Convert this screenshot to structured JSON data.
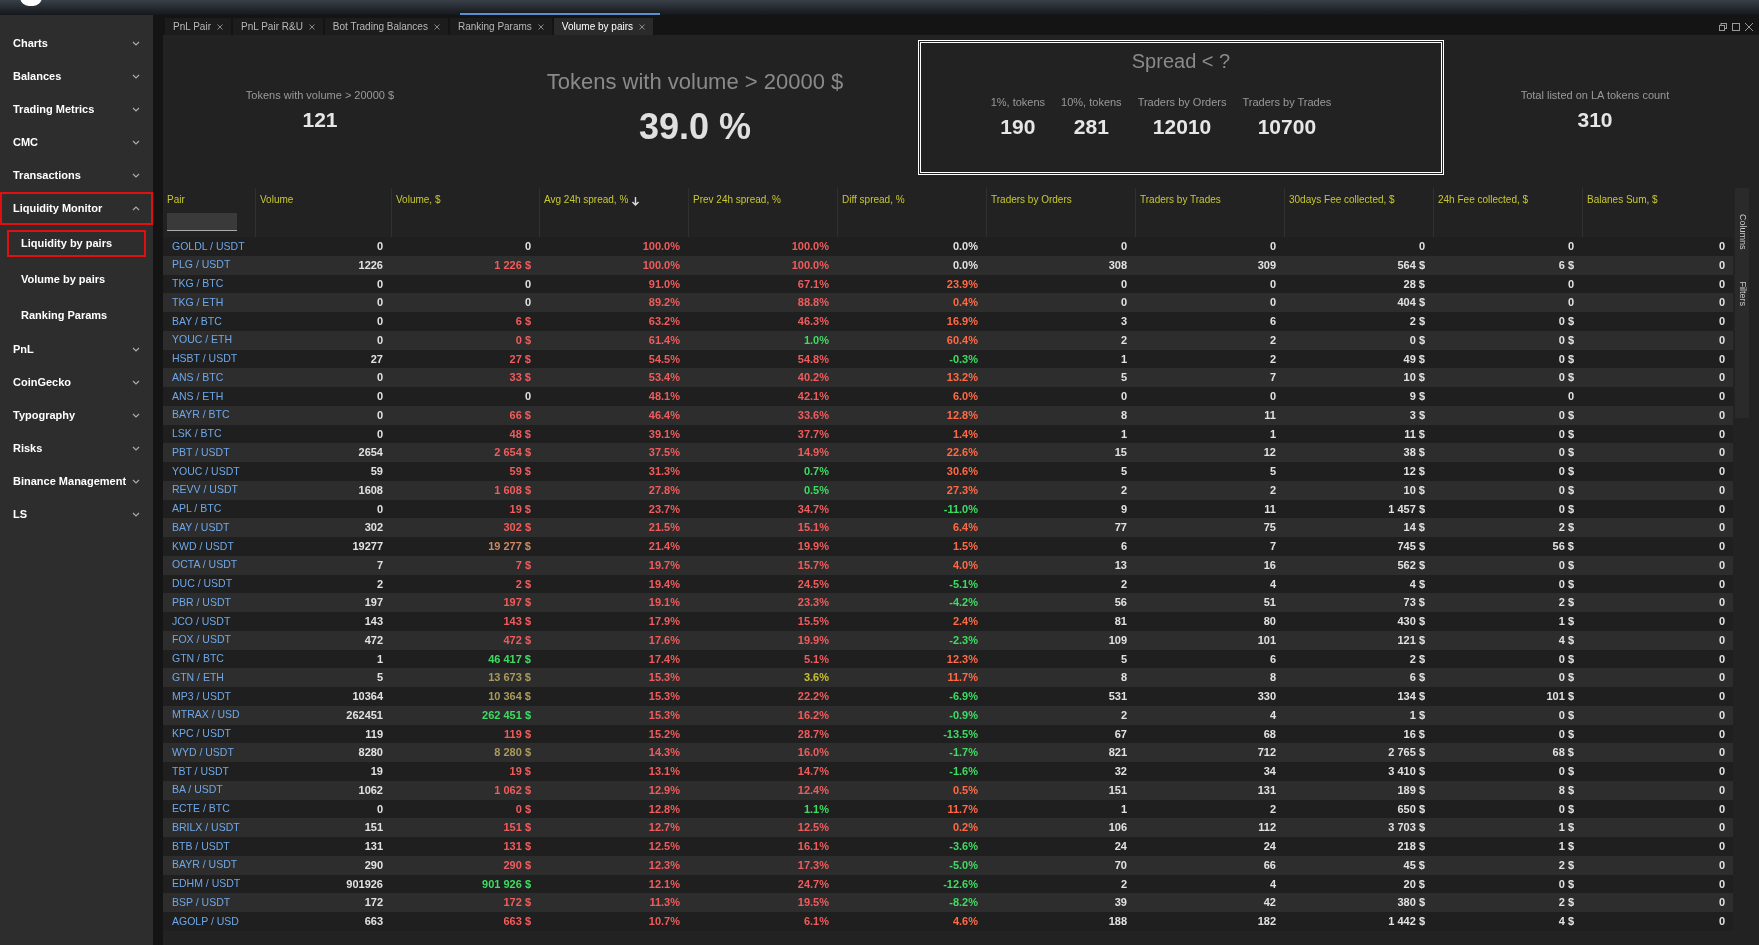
{
  "sidebar": {
    "items": [
      {
        "label": "Charts",
        "expanded": false
      },
      {
        "label": "Balances",
        "expanded": false
      },
      {
        "label": "Trading Metrics",
        "expanded": false
      },
      {
        "label": "CMC",
        "expanded": false
      },
      {
        "label": "Transactions",
        "expanded": false
      },
      {
        "label": "Liquidity Monitor",
        "expanded": true,
        "children": [
          {
            "label": "Liquidity by pairs",
            "selected": true
          },
          {
            "label": "Volume by pairs",
            "selected": false
          },
          {
            "label": "Ranking Params",
            "selected": false
          }
        ]
      },
      {
        "label": "PnL",
        "expanded": false
      },
      {
        "label": "CoinGecko",
        "expanded": false
      },
      {
        "label": "Typography",
        "expanded": false
      },
      {
        "label": "Risks",
        "expanded": false
      },
      {
        "label": "Binance Management",
        "expanded": false
      },
      {
        "label": "LS",
        "expanded": false
      }
    ]
  },
  "tabs": [
    {
      "label": "PnL Pair",
      "selected": false
    },
    {
      "label": "PnL Pair R&U",
      "selected": false
    },
    {
      "label": "Bot Trading Balances",
      "selected": false
    },
    {
      "label": "Ranking Params",
      "selected": false
    },
    {
      "label": "Volume by pairs",
      "selected": true
    }
  ],
  "stats": {
    "small": {
      "label": "Tokens with volume > 20000 $",
      "value": "121"
    },
    "big": {
      "label": "Tokens with volume > 20000 $",
      "value": "39.0 %"
    },
    "spread": {
      "title": "Spread < ?",
      "items": [
        {
          "label": "1%, tokens",
          "value": "190"
        },
        {
          "label": "10%, tokens",
          "value": "281"
        },
        {
          "label": "Traders by Orders",
          "value": "12010"
        },
        {
          "label": "Traders by Trades",
          "value": "10700"
        }
      ]
    },
    "total": {
      "label": "Total listed on LA tokens count",
      "value": "310"
    }
  },
  "table": {
    "columns": [
      {
        "label": "Pair",
        "sorted": false
      },
      {
        "label": "Volume",
        "sorted": false
      },
      {
        "label": "Volume, $",
        "sorted": false
      },
      {
        "label": "Avg 24h spread, %",
        "sorted": true
      },
      {
        "label": "Prev 24h spread, %",
        "sorted": false
      },
      {
        "label": "Diff spread, %",
        "sorted": false
      },
      {
        "label": "Traders by Orders",
        "sorted": false
      },
      {
        "label": "Traders by Trades",
        "sorted": false
      },
      {
        "label": "30days Fee collected, $",
        "sorted": false
      },
      {
        "label": "24h Fee collected, $",
        "sorted": false
      },
      {
        "label": "Balanes Sum, $",
        "sorted": false
      }
    ],
    "rows": [
      {
        "pair": "GOLDL / USDT",
        "cells": [
          {
            "text": "0"
          },
          {
            "text": "0"
          },
          {
            "text": "100.0%",
            "color": "#f05c5c"
          },
          {
            "text": "100.0%",
            "color": "#f05c5c"
          },
          {
            "text": "0.0%"
          },
          {
            "text": "0"
          },
          {
            "text": "0"
          },
          {
            "text": "0"
          },
          {
            "text": "0"
          },
          {
            "text": "0"
          }
        ]
      },
      {
        "pair": "PLG / USDT",
        "cells": [
          {
            "text": "1226"
          },
          {
            "text": "1 226 $",
            "color": "#f05c5c"
          },
          {
            "text": "100.0%",
            "color": "#f05c5c"
          },
          {
            "text": "100.0%",
            "color": "#f05c5c"
          },
          {
            "text": "0.0%"
          },
          {
            "text": "308"
          },
          {
            "text": "309"
          },
          {
            "text": "564 $"
          },
          {
            "text": "6 $"
          },
          {
            "text": "0"
          }
        ]
      },
      {
        "pair": "TKG / BTC",
        "cells": [
          {
            "text": "0"
          },
          {
            "text": "0"
          },
          {
            "text": "91.0%",
            "color": "#f05c5c"
          },
          {
            "text": "67.1%",
            "color": "#f05c5c"
          },
          {
            "text": "23.9%",
            "color": "#ff6a45"
          },
          {
            "text": "0"
          },
          {
            "text": "0"
          },
          {
            "text": "28 $"
          },
          {
            "text": "0"
          },
          {
            "text": "0"
          }
        ]
      },
      {
        "pair": "TKG / ETH",
        "cells": [
          {
            "text": "0"
          },
          {
            "text": "0"
          },
          {
            "text": "89.2%",
            "color": "#f05c5c"
          },
          {
            "text": "88.8%",
            "color": "#f05c5c"
          },
          {
            "text": "0.4%",
            "color": "#ff6a45"
          },
          {
            "text": "0"
          },
          {
            "text": "0"
          },
          {
            "text": "404 $"
          },
          {
            "text": "0"
          },
          {
            "text": "0"
          }
        ]
      },
      {
        "pair": "BAY / BTC",
        "cells": [
          {
            "text": "0"
          },
          {
            "text": "6 $",
            "color": "#f05c5c"
          },
          {
            "text": "63.2%",
            "color": "#f05c5c"
          },
          {
            "text": "46.3%",
            "color": "#f05c5c"
          },
          {
            "text": "16.9%",
            "color": "#ff6a45"
          },
          {
            "text": "3"
          },
          {
            "text": "6"
          },
          {
            "text": "2 $"
          },
          {
            "text": "0 $"
          },
          {
            "text": "0"
          }
        ]
      },
      {
        "pair": "YOUC / ETH",
        "cells": [
          {
            "text": "0"
          },
          {
            "text": "0 $",
            "color": "#f05c5c"
          },
          {
            "text": "61.4%",
            "color": "#f05c5c"
          },
          {
            "text": "1.0%",
            "color": "#3ddc62"
          },
          {
            "text": "60.4%",
            "color": "#ff6a45"
          },
          {
            "text": "2"
          },
          {
            "text": "2"
          },
          {
            "text": "0 $"
          },
          {
            "text": "0 $"
          },
          {
            "text": "0"
          }
        ]
      },
      {
        "pair": "HSBT / USDT",
        "cells": [
          {
            "text": "27"
          },
          {
            "text": "27 $",
            "color": "#f05c5c"
          },
          {
            "text": "54.5%",
            "color": "#f05c5c"
          },
          {
            "text": "54.8%",
            "color": "#f05c5c"
          },
          {
            "text": "-0.3%",
            "color": "#3ddc62"
          },
          {
            "text": "1"
          },
          {
            "text": "2"
          },
          {
            "text": "49 $"
          },
          {
            "text": "0 $"
          },
          {
            "text": "0"
          }
        ]
      },
      {
        "pair": "ANS / BTC",
        "cells": [
          {
            "text": "0"
          },
          {
            "text": "33 $",
            "color": "#f05c5c"
          },
          {
            "text": "53.4%",
            "color": "#f05c5c"
          },
          {
            "text": "40.2%",
            "color": "#f05c5c"
          },
          {
            "text": "13.2%",
            "color": "#ff6a45"
          },
          {
            "text": "5"
          },
          {
            "text": "7"
          },
          {
            "text": "10 $"
          },
          {
            "text": "0 $"
          },
          {
            "text": "0"
          }
        ]
      },
      {
        "pair": "ANS / ETH",
        "cells": [
          {
            "text": "0"
          },
          {
            "text": "0"
          },
          {
            "text": "48.1%",
            "color": "#f05c5c"
          },
          {
            "text": "42.1%",
            "color": "#f05c5c"
          },
          {
            "text": "6.0%",
            "color": "#ff6a45"
          },
          {
            "text": "0"
          },
          {
            "text": "0"
          },
          {
            "text": "9 $"
          },
          {
            "text": "0"
          },
          {
            "text": "0"
          }
        ]
      },
      {
        "pair": "BAYR / BTC",
        "cells": [
          {
            "text": "0"
          },
          {
            "text": "66 $",
            "color": "#f05c5c"
          },
          {
            "text": "46.4%",
            "color": "#f05c5c"
          },
          {
            "text": "33.6%",
            "color": "#f05c5c"
          },
          {
            "text": "12.8%",
            "color": "#ff6a45"
          },
          {
            "text": "8"
          },
          {
            "text": "11"
          },
          {
            "text": "3 $"
          },
          {
            "text": "0 $"
          },
          {
            "text": "0"
          }
        ]
      },
      {
        "pair": "LSK / BTC",
        "cells": [
          {
            "text": "0"
          },
          {
            "text": "48 $",
            "color": "#f05c5c"
          },
          {
            "text": "39.1%",
            "color": "#f05c5c"
          },
          {
            "text": "37.7%",
            "color": "#f05c5c"
          },
          {
            "text": "1.4%",
            "color": "#ff6a45"
          },
          {
            "text": "1"
          },
          {
            "text": "1"
          },
          {
            "text": "11 $"
          },
          {
            "text": "0 $"
          },
          {
            "text": "0"
          }
        ]
      },
      {
        "pair": "PBT / USDT",
        "cells": [
          {
            "text": "2654"
          },
          {
            "text": "2 654 $",
            "color": "#f05c5c"
          },
          {
            "text": "37.5%",
            "color": "#f05c5c"
          },
          {
            "text": "14.9%",
            "color": "#f05c5c"
          },
          {
            "text": "22.6%",
            "color": "#ff6a45"
          },
          {
            "text": "15"
          },
          {
            "text": "12"
          },
          {
            "text": "38 $"
          },
          {
            "text": "0 $"
          },
          {
            "text": "0"
          }
        ]
      },
      {
        "pair": "YOUC / USDT",
        "cells": [
          {
            "text": "59"
          },
          {
            "text": "59 $",
            "color": "#f05c5c"
          },
          {
            "text": "31.3%",
            "color": "#f05c5c"
          },
          {
            "text": "0.7%",
            "color": "#3ddc62"
          },
          {
            "text": "30.6%",
            "color": "#ff6a45"
          },
          {
            "text": "5"
          },
          {
            "text": "5"
          },
          {
            "text": "12 $"
          },
          {
            "text": "0 $"
          },
          {
            "text": "0"
          }
        ]
      },
      {
        "pair": "REVV / USDT",
        "cells": [
          {
            "text": "1608"
          },
          {
            "text": "1 608 $",
            "color": "#f05c5c"
          },
          {
            "text": "27.8%",
            "color": "#f05c5c"
          },
          {
            "text": "0.5%",
            "color": "#3ddc62"
          },
          {
            "text": "27.3%",
            "color": "#ff6a45"
          },
          {
            "text": "2"
          },
          {
            "text": "2"
          },
          {
            "text": "10 $"
          },
          {
            "text": "0 $"
          },
          {
            "text": "0"
          }
        ]
      },
      {
        "pair": "APL / BTC",
        "cells": [
          {
            "text": "0"
          },
          {
            "text": "19 $",
            "color": "#f05c5c"
          },
          {
            "text": "23.7%",
            "color": "#f05c5c"
          },
          {
            "text": "34.7%",
            "color": "#f05c5c"
          },
          {
            "text": "-11.0%",
            "color": "#3ddc62"
          },
          {
            "text": "9"
          },
          {
            "text": "11"
          },
          {
            "text": "1 457 $"
          },
          {
            "text": "0 $"
          },
          {
            "text": "0"
          }
        ]
      },
      {
        "pair": "BAY / USDT",
        "cells": [
          {
            "text": "302"
          },
          {
            "text": "302 $",
            "color": "#f05c5c"
          },
          {
            "text": "21.5%",
            "color": "#f05c5c"
          },
          {
            "text": "15.1%",
            "color": "#f05c5c"
          },
          {
            "text": "6.4%",
            "color": "#ff6a45"
          },
          {
            "text": "77"
          },
          {
            "text": "75"
          },
          {
            "text": "14 $"
          },
          {
            "text": "2 $"
          },
          {
            "text": "0"
          }
        ]
      },
      {
        "pair": "KWD / USDT",
        "cells": [
          {
            "text": "19277"
          },
          {
            "text": "19 277 $",
            "color": "#c98a66"
          },
          {
            "text": "21.4%",
            "color": "#f05c5c"
          },
          {
            "text": "19.9%",
            "color": "#f05c5c"
          },
          {
            "text": "1.5%",
            "color": "#ff6a45"
          },
          {
            "text": "6"
          },
          {
            "text": "7"
          },
          {
            "text": "745 $"
          },
          {
            "text": "56 $"
          },
          {
            "text": "0"
          }
        ]
      },
      {
        "pair": "OCTA / USDT",
        "cells": [
          {
            "text": "7"
          },
          {
            "text": "7 $",
            "color": "#f05c5c"
          },
          {
            "text": "19.7%",
            "color": "#f05c5c"
          },
          {
            "text": "15.7%",
            "color": "#f05c5c"
          },
          {
            "text": "4.0%",
            "color": "#ff6a45"
          },
          {
            "text": "13"
          },
          {
            "text": "16"
          },
          {
            "text": "562 $"
          },
          {
            "text": "0 $"
          },
          {
            "text": "0"
          }
        ]
      },
      {
        "pair": "DUC / USDT",
        "cells": [
          {
            "text": "2"
          },
          {
            "text": "2 $",
            "color": "#f05c5c"
          },
          {
            "text": "19.4%",
            "color": "#f05c5c"
          },
          {
            "text": "24.5%",
            "color": "#f05c5c"
          },
          {
            "text": "-5.1%",
            "color": "#3ddc62"
          },
          {
            "text": "2"
          },
          {
            "text": "4"
          },
          {
            "text": "4 $"
          },
          {
            "text": "0 $"
          },
          {
            "text": "0"
          }
        ]
      },
      {
        "pair": "PBR / USDT",
        "cells": [
          {
            "text": "197"
          },
          {
            "text": "197 $",
            "color": "#f05c5c"
          },
          {
            "text": "19.1%",
            "color": "#f05c5c"
          },
          {
            "text": "23.3%",
            "color": "#f05c5c"
          },
          {
            "text": "-4.2%",
            "color": "#3ddc62"
          },
          {
            "text": "56"
          },
          {
            "text": "51"
          },
          {
            "text": "73 $"
          },
          {
            "text": "2 $"
          },
          {
            "text": "0"
          }
        ]
      },
      {
        "pair": "JCO / USDT",
        "cells": [
          {
            "text": "143"
          },
          {
            "text": "143 $",
            "color": "#f05c5c"
          },
          {
            "text": "17.9%",
            "color": "#f05c5c"
          },
          {
            "text": "15.5%",
            "color": "#f05c5c"
          },
          {
            "text": "2.4%",
            "color": "#ff6a45"
          },
          {
            "text": "81"
          },
          {
            "text": "80"
          },
          {
            "text": "430 $"
          },
          {
            "text": "1 $"
          },
          {
            "text": "0"
          }
        ]
      },
      {
        "pair": "FOX / USDT",
        "cells": [
          {
            "text": "472"
          },
          {
            "text": "472 $",
            "color": "#f05c5c"
          },
          {
            "text": "17.6%",
            "color": "#f05c5c"
          },
          {
            "text": "19.9%",
            "color": "#f05c5c"
          },
          {
            "text": "-2.3%",
            "color": "#3ddc62"
          },
          {
            "text": "109"
          },
          {
            "text": "101"
          },
          {
            "text": "121 $"
          },
          {
            "text": "4 $"
          },
          {
            "text": "0"
          }
        ]
      },
      {
        "pair": "GTN / BTC",
        "cells": [
          {
            "text": "1"
          },
          {
            "text": "46 417 $",
            "color": "#3ddc62"
          },
          {
            "text": "17.4%",
            "color": "#f05c5c"
          },
          {
            "text": "5.1%",
            "color": "#f05c5c"
          },
          {
            "text": "12.3%",
            "color": "#ff6a45"
          },
          {
            "text": "5"
          },
          {
            "text": "6"
          },
          {
            "text": "2 $"
          },
          {
            "text": "0 $"
          },
          {
            "text": "0"
          }
        ]
      },
      {
        "pair": "GTN / ETH",
        "cells": [
          {
            "text": "5"
          },
          {
            "text": "13 673 $",
            "color": "#a89a5c"
          },
          {
            "text": "15.3%",
            "color": "#f05c5c"
          },
          {
            "text": "3.6%",
            "color": "#c8c030"
          },
          {
            "text": "11.7%",
            "color": "#ff6a45"
          },
          {
            "text": "8"
          },
          {
            "text": "8"
          },
          {
            "text": "6 $"
          },
          {
            "text": "0 $"
          },
          {
            "text": "0"
          }
        ]
      },
      {
        "pair": "MP3 / USDT",
        "cells": [
          {
            "text": "10364"
          },
          {
            "text": "10 364 $",
            "color": "#a89a5c"
          },
          {
            "text": "15.3%",
            "color": "#f05c5c"
          },
          {
            "text": "22.2%",
            "color": "#f05c5c"
          },
          {
            "text": "-6.9%",
            "color": "#3ddc62"
          },
          {
            "text": "531"
          },
          {
            "text": "330"
          },
          {
            "text": "134 $"
          },
          {
            "text": "101 $"
          },
          {
            "text": "0"
          }
        ]
      },
      {
        "pair": "MTRAX / USD",
        "cells": [
          {
            "text": "262451"
          },
          {
            "text": "262 451 $",
            "color": "#3ddc62"
          },
          {
            "text": "15.3%",
            "color": "#f05c5c"
          },
          {
            "text": "16.2%",
            "color": "#f05c5c"
          },
          {
            "text": "-0.9%",
            "color": "#3ddc62"
          },
          {
            "text": "2"
          },
          {
            "text": "4"
          },
          {
            "text": "1 $"
          },
          {
            "text": "0 $"
          },
          {
            "text": "0"
          }
        ]
      },
      {
        "pair": "KPC / USDT",
        "cells": [
          {
            "text": "119"
          },
          {
            "text": "119 $",
            "color": "#f05c5c"
          },
          {
            "text": "15.2%",
            "color": "#f05c5c"
          },
          {
            "text": "28.7%",
            "color": "#f05c5c"
          },
          {
            "text": "-13.5%",
            "color": "#3ddc62"
          },
          {
            "text": "67"
          },
          {
            "text": "68"
          },
          {
            "text": "16 $"
          },
          {
            "text": "0 $"
          },
          {
            "text": "0"
          }
        ]
      },
      {
        "pair": "WYD / USDT",
        "cells": [
          {
            "text": "8280"
          },
          {
            "text": "8 280 $",
            "color": "#a89a5c"
          },
          {
            "text": "14.3%",
            "color": "#f05c5c"
          },
          {
            "text": "16.0%",
            "color": "#f05c5c"
          },
          {
            "text": "-1.7%",
            "color": "#3ddc62"
          },
          {
            "text": "821"
          },
          {
            "text": "712"
          },
          {
            "text": "2 765 $"
          },
          {
            "text": "68 $"
          },
          {
            "text": "0"
          }
        ]
      },
      {
        "pair": "TBT / USDT",
        "cells": [
          {
            "text": "19"
          },
          {
            "text": "19 $",
            "color": "#f05c5c"
          },
          {
            "text": "13.1%",
            "color": "#f05c5c"
          },
          {
            "text": "14.7%",
            "color": "#f05c5c"
          },
          {
            "text": "-1.6%",
            "color": "#3ddc62"
          },
          {
            "text": "32"
          },
          {
            "text": "34"
          },
          {
            "text": "3 410 $"
          },
          {
            "text": "0 $"
          },
          {
            "text": "0"
          }
        ]
      },
      {
        "pair": "BA / USDT",
        "cells": [
          {
            "text": "1062"
          },
          {
            "text": "1 062 $",
            "color": "#f05c5c"
          },
          {
            "text": "12.9%",
            "color": "#f05c5c"
          },
          {
            "text": "12.4%",
            "color": "#f05c5c"
          },
          {
            "text": "0.5%",
            "color": "#ff6a45"
          },
          {
            "text": "151"
          },
          {
            "text": "131"
          },
          {
            "text": "189 $"
          },
          {
            "text": "8 $"
          },
          {
            "text": "0"
          }
        ]
      },
      {
        "pair": "ECTE / BTC",
        "cells": [
          {
            "text": "0"
          },
          {
            "text": "0 $",
            "color": "#f05c5c"
          },
          {
            "text": "12.8%",
            "color": "#f05c5c"
          },
          {
            "text": "1.1%",
            "color": "#3ddc62"
          },
          {
            "text": "11.7%",
            "color": "#ff6a45"
          },
          {
            "text": "1"
          },
          {
            "text": "2"
          },
          {
            "text": "650 $"
          },
          {
            "text": "0 $"
          },
          {
            "text": "0"
          }
        ]
      },
      {
        "pair": "BRILX / USDT",
        "cells": [
          {
            "text": "151"
          },
          {
            "text": "151 $",
            "color": "#f05c5c"
          },
          {
            "text": "12.7%",
            "color": "#f05c5c"
          },
          {
            "text": "12.5%",
            "color": "#f05c5c"
          },
          {
            "text": "0.2%",
            "color": "#ff6a45"
          },
          {
            "text": "106"
          },
          {
            "text": "112"
          },
          {
            "text": "3 703 $"
          },
          {
            "text": "1 $"
          },
          {
            "text": "0"
          }
        ]
      },
      {
        "pair": "BTB / USDT",
        "cells": [
          {
            "text": "131"
          },
          {
            "text": "131 $",
            "color": "#f05c5c"
          },
          {
            "text": "12.5%",
            "color": "#f05c5c"
          },
          {
            "text": "16.1%",
            "color": "#f05c5c"
          },
          {
            "text": "-3.6%",
            "color": "#3ddc62"
          },
          {
            "text": "24"
          },
          {
            "text": "24"
          },
          {
            "text": "218 $"
          },
          {
            "text": "1 $"
          },
          {
            "text": "0"
          }
        ]
      },
      {
        "pair": "BAYR / USDT",
        "cells": [
          {
            "text": "290"
          },
          {
            "text": "290 $",
            "color": "#f05c5c"
          },
          {
            "text": "12.3%",
            "color": "#f05c5c"
          },
          {
            "text": "17.3%",
            "color": "#f05c5c"
          },
          {
            "text": "-5.0%",
            "color": "#3ddc62"
          },
          {
            "text": "70"
          },
          {
            "text": "66"
          },
          {
            "text": "45 $"
          },
          {
            "text": "2 $"
          },
          {
            "text": "0"
          }
        ]
      },
      {
        "pair": "EDHM / USDT",
        "cells": [
          {
            "text": "901926"
          },
          {
            "text": "901 926 $",
            "color": "#3ddc62"
          },
          {
            "text": "12.1%",
            "color": "#f05c5c"
          },
          {
            "text": "24.7%",
            "color": "#f05c5c"
          },
          {
            "text": "-12.6%",
            "color": "#3ddc62"
          },
          {
            "text": "2"
          },
          {
            "text": "4"
          },
          {
            "text": "20 $"
          },
          {
            "text": "0 $"
          },
          {
            "text": "0"
          }
        ]
      },
      {
        "pair": "BSP / USDT",
        "cells": [
          {
            "text": "172"
          },
          {
            "text": "172 $",
            "color": "#f05c5c"
          },
          {
            "text": "11.3%",
            "color": "#f05c5c"
          },
          {
            "text": "19.5%",
            "color": "#f05c5c"
          },
          {
            "text": "-8.2%",
            "color": "#3ddc62"
          },
          {
            "text": "39"
          },
          {
            "text": "42"
          },
          {
            "text": "380 $"
          },
          {
            "text": "2 $"
          },
          {
            "text": "0"
          }
        ]
      },
      {
        "pair": "AGOLP / USD",
        "cells": [
          {
            "text": "663"
          },
          {
            "text": "663 $",
            "color": "#f05c5c"
          },
          {
            "text": "10.7%",
            "color": "#f05c5c"
          },
          {
            "text": "6.1%",
            "color": "#f05c5c"
          },
          {
            "text": "4.6%",
            "color": "#ff6a45"
          },
          {
            "text": "188"
          },
          {
            "text": "182"
          },
          {
            "text": "1 442 $"
          },
          {
            "text": "4 $"
          },
          {
            "text": "0"
          }
        ]
      }
    ]
  },
  "side_panel": {
    "buttons": [
      "Columns",
      "Filters"
    ]
  }
}
